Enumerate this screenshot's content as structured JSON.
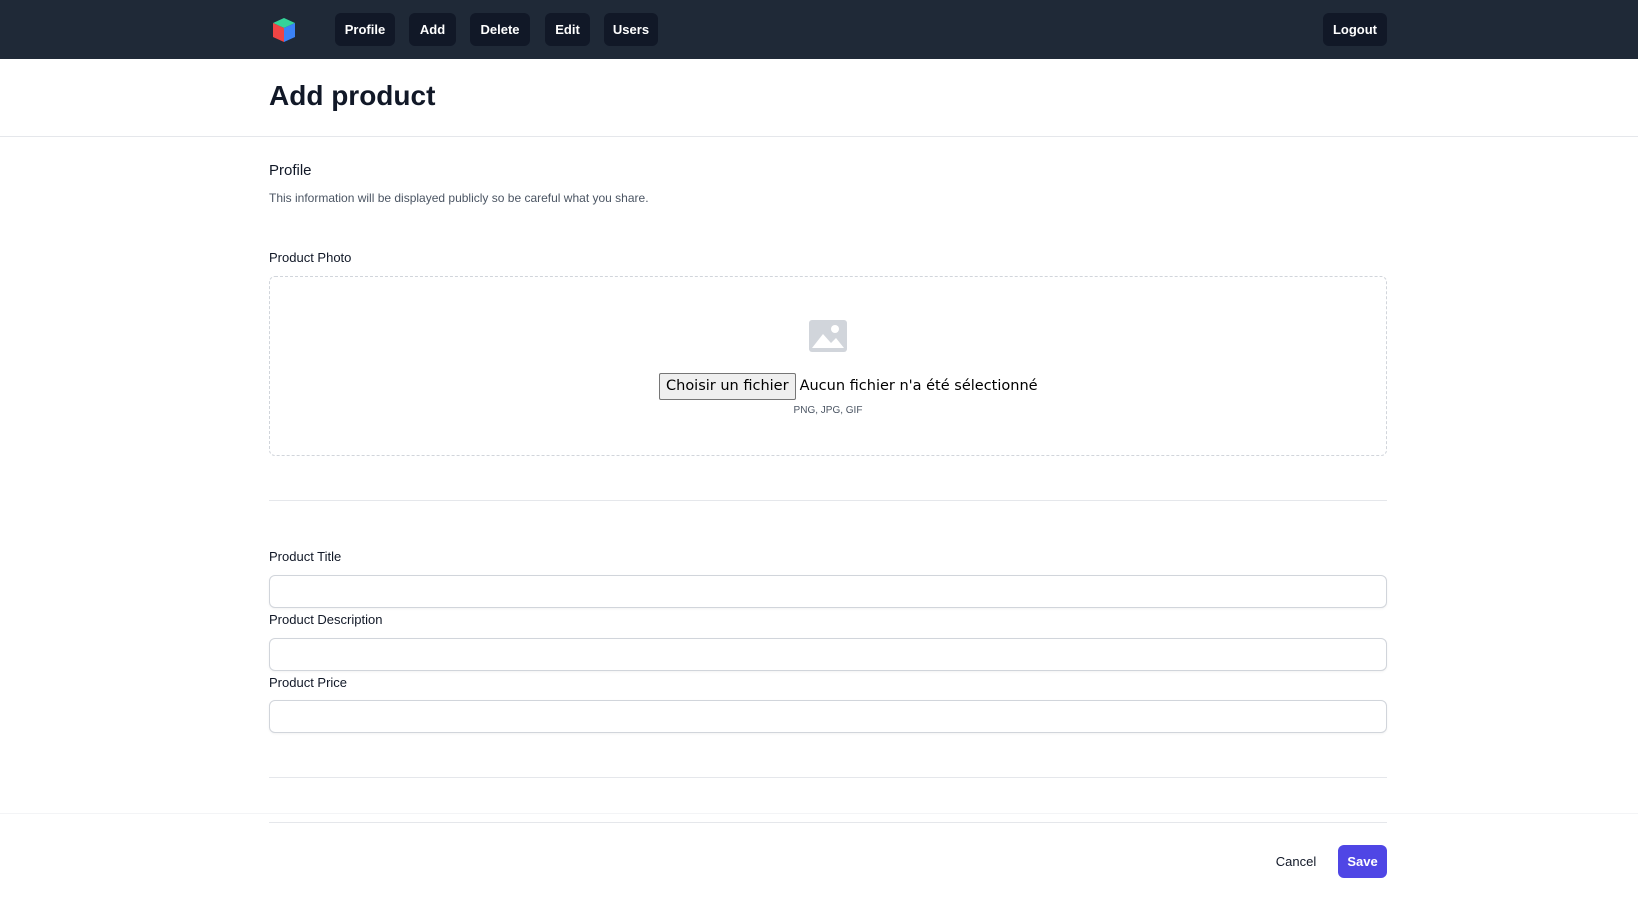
{
  "nav": {
    "items": [
      {
        "label": "Profile"
      },
      {
        "label": "Add"
      },
      {
        "label": "Delete"
      },
      {
        "label": "Edit"
      },
      {
        "label": "Users"
      }
    ],
    "logout_label": "Logout",
    "logo_icon": "cube-logo-icon",
    "background_color": "#1f2937",
    "button_color": "#111827"
  },
  "page": {
    "title": "Add product"
  },
  "section": {
    "title": "Profile",
    "description": "This information will be displayed publicly so be careful what you share."
  },
  "photo": {
    "label": "Product Photo",
    "icon": "image-icon",
    "file_button_label": "Choisir un fichier",
    "file_status": "Aucun fichier n'a été sélectionné",
    "accepted_types": "PNG, JPG, GIF"
  },
  "fields": {
    "title_label": "Product Title",
    "title_value": "",
    "description_label": "Product Description",
    "description_value": "",
    "price_label": "Product Price",
    "price_value": ""
  },
  "actions": {
    "cancel_label": "Cancel",
    "save_label": "Save",
    "save_color": "#4f46e5"
  }
}
